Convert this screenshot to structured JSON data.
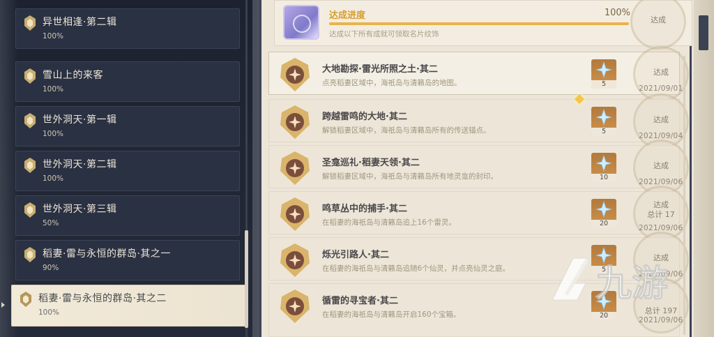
{
  "sidebar": {
    "categories": [
      {
        "name": "异世相逢·第二辑",
        "percent": "100%"
      },
      {
        "name": "雪山上的来客",
        "percent": "100%"
      },
      {
        "name": "世外洞天·第一辑",
        "percent": "100%"
      },
      {
        "name": "世外洞天·第二辑",
        "percent": "100%"
      },
      {
        "name": "世外洞天·第三辑",
        "percent": "50%"
      },
      {
        "name": "稻妻·雷与永恒的群岛·其之一",
        "percent": "90%"
      },
      {
        "name": "稻妻·雷与永恒的群岛·其之二",
        "percent": "100%",
        "selected": true
      }
    ]
  },
  "progress": {
    "title": "达成进度",
    "percent": "100%",
    "fill_fraction": 1.0,
    "description": "达成以下所有成就可领取名片纹饰",
    "stamp_label": "达成"
  },
  "achievements": [
    {
      "title": "大地勘探·雷光所照之土·其二",
      "desc": "点亮稻妻区域中，海祇岛与清籁岛的地图。",
      "reward": "5",
      "stamp": "达成",
      "total": "",
      "date": "2021/09/01"
    },
    {
      "title": "跨越雷鸣的大地·其二",
      "desc": "解锁稻妻区域中，海祇岛与清籁岛所有的传送锚点。",
      "reward": "5",
      "stamp": "达成",
      "total": "",
      "date": "2021/09/04"
    },
    {
      "title": "圣龛巡礼·稻妻天领·其二",
      "desc": "解锁稻妻区域中，海祇岛与清籁岛所有地灵龛的封印。",
      "reward": "10",
      "stamp": "达成",
      "total": "",
      "date": "2021/09/06"
    },
    {
      "title": "鸣草丛中的捕手·其二",
      "desc": "在稻妻的海祇岛与清籁岛追上16个雷灵。",
      "reward": "20",
      "stamp": "达成",
      "total": "总计 17",
      "date": "2021/09/06"
    },
    {
      "title": "烁光引路人·其二",
      "desc": "在稻妻的海祇岛与清籁岛追随6个仙灵，并点亮仙灵之庭。",
      "reward": "5",
      "stamp": "达成",
      "total": "",
      "date": "2021/09/06"
    },
    {
      "title": "循雷的寻宝者·其二",
      "desc": "在稻妻的海祇岛与清籁岛开启160个宝箱。",
      "reward": "20",
      "stamp": "",
      "total": "总计 197",
      "date": "2021/09/06"
    }
  ],
  "watermark": {
    "text": "九游"
  },
  "colors": {
    "accent": "#d79e2d",
    "panel_bg": "#ece5d8",
    "sidebar_bg": "#242a39"
  }
}
